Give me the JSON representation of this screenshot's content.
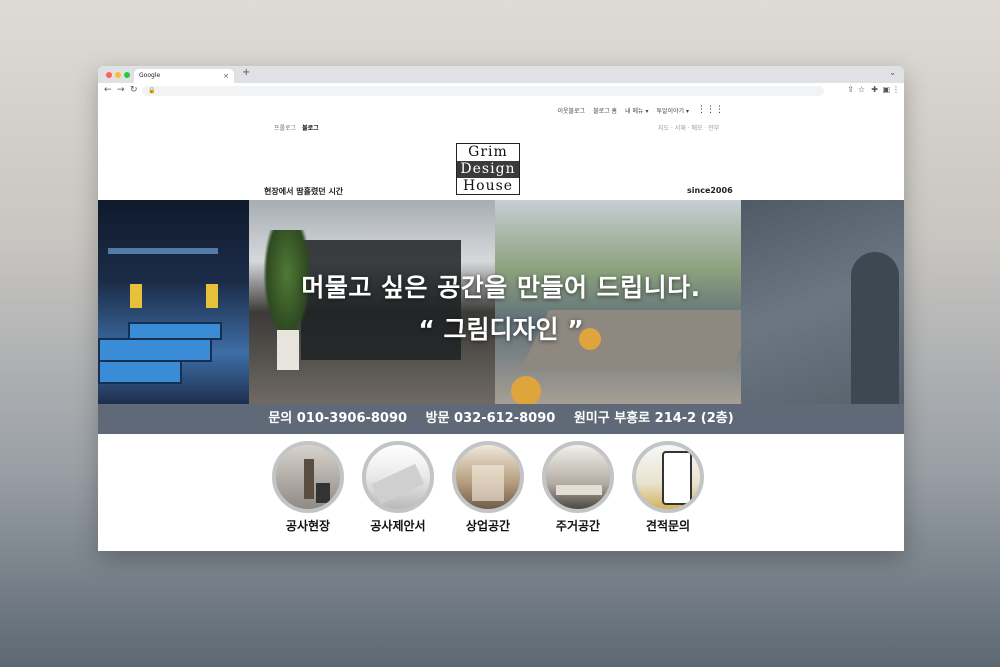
{
  "browser": {
    "tab_title": "Google",
    "tab_close": "×",
    "new_tab": "+",
    "nav": {
      "back": "←",
      "forward": "→",
      "reload": "↻"
    }
  },
  "top_nav": {
    "links": [
      "이웃블로그",
      "블로그 홈",
      "내 메뉴 ▾",
      "투알이야기 ▾"
    ],
    "apps": "⋮⋮⋮"
  },
  "blog_links": [
    "프롤로그",
    "블로그"
  ],
  "side_links": "지도 · 서재 · 메모 · 안부",
  "logo": {
    "line1": "Grim",
    "line2": "Design",
    "line3": "House"
  },
  "tagline": "현장에서 땀흘렸던 시간",
  "since": "since2006",
  "hero": {
    "line1": "머물고 싶은 공간을 만들어 드립니다.",
    "line2": "“ 그림디자인 ”"
  },
  "info": {
    "inquiry": "문의 010-3906-8090",
    "visit": "방문 032-612-8090",
    "address": "원미구 부흥로 214-2 (2층)"
  },
  "categories": [
    "공사현장",
    "공사제안서",
    "상업공간",
    "주거공간",
    "견적문의"
  ]
}
